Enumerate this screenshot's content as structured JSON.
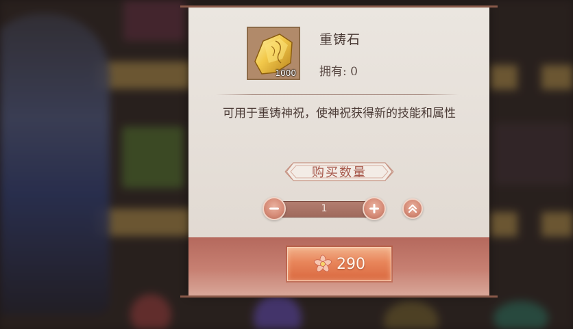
{
  "item": {
    "name": "重铸石",
    "owned": "拥有: 0",
    "stack_count": "1000",
    "icon": "forging-stone-icon"
  },
  "description": "可用于重铸神祝，使神祝获得新的技能和属性",
  "purchase": {
    "title": "购买数量",
    "quantity": "1",
    "price": "290",
    "currency_icon": "lotus-currency-icon"
  },
  "colors": {
    "accent": "#a6574a",
    "footer": "#b5695d",
    "button": "#e8855a"
  }
}
